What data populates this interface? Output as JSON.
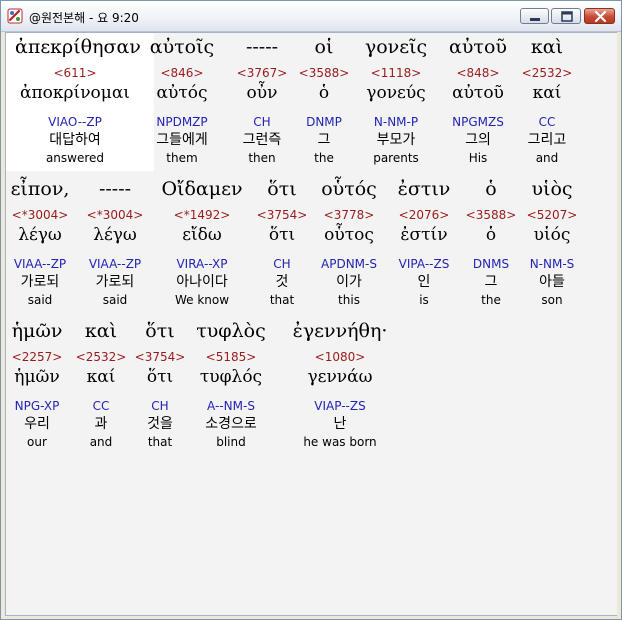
{
  "window": {
    "title": "@원전본해 - 요 9:20"
  },
  "rows": [
    {
      "words": [
        {
          "greek": "ἀπεκρίθησαν",
          "strong": "<611>",
          "lemma": "ἀποκρίνομαι",
          "parse": "VIAO--ZP",
          "korean": "대답하여",
          "english": "answered"
        },
        {
          "greek": "αὐτοῖς",
          "strong": "<846>",
          "lemma": "αὐτός",
          "parse": "NPDMZP",
          "korean": "그들에게",
          "english": "them"
        },
        {
          "greek": "-----",
          "strong": "<3767>",
          "lemma": "οὖν",
          "parse": "CH",
          "korean": "그런즉",
          "english": "then"
        },
        {
          "greek": "οἱ",
          "strong": "<3588>",
          "lemma": "ὁ",
          "parse": "DNMP",
          "korean": "그",
          "english": "the"
        },
        {
          "greek": "γονεῖς",
          "strong": "<1118>",
          "lemma": "γονεύς",
          "parse": "N-NM-P",
          "korean": "부모가",
          "english": "parents"
        },
        {
          "greek": "αὐτοῦ",
          "strong": "<848>",
          "lemma": "αὐτοῦ",
          "parse": "NPGMZS",
          "korean": "그의",
          "english": "His"
        },
        {
          "greek": "καὶ",
          "strong": "<2532>",
          "lemma": "καί",
          "parse": "CC",
          "korean": "그리고",
          "english": "and"
        }
      ]
    },
    {
      "words": [
        {
          "greek": "εἶπον,",
          "strong": "<*3004>",
          "lemma": "λέγω",
          "parse": "VIAA--ZP",
          "korean": "가로되",
          "english": "said"
        },
        {
          "greek": "-----",
          "strong": "<*3004>",
          "lemma": "λέγω",
          "parse": "VIAA--ZP",
          "korean": "가로되",
          "english": "said"
        },
        {
          "greek": "Οἴδαμεν",
          "strong": "<*1492>",
          "lemma": "εἴδω",
          "parse": "VIRA--XP",
          "korean": "아나이다",
          "english": "We know"
        },
        {
          "greek": "ὅτι",
          "strong": "<3754>",
          "lemma": "ὅτι",
          "parse": "CH",
          "korean": "것",
          "english": "that"
        },
        {
          "greek": "οὗτός",
          "strong": "<3778>",
          "lemma": "οὗτος",
          "parse": "APDNM-S",
          "korean": "이가",
          "english": "this"
        },
        {
          "greek": "ἐστιν",
          "strong": "<2076>",
          "lemma": "ἐστίν",
          "parse": "VIPA--ZS",
          "korean": "인",
          "english": "is"
        },
        {
          "greek": "ὁ",
          "strong": "<3588>",
          "lemma": "ὁ",
          "parse": "DNMS",
          "korean": "그",
          "english": "the"
        },
        {
          "greek": "υἱὸς",
          "strong": "<5207>",
          "lemma": "υἱός",
          "parse": "N-NM-S",
          "korean": "아들",
          "english": "son"
        }
      ]
    },
    {
      "words": [
        {
          "greek": "ἡμῶν",
          "strong": "<2257>",
          "lemma": "ἡμῶν",
          "parse": "NPG-XP",
          "korean": "우리",
          "english": "our"
        },
        {
          "greek": "καὶ",
          "strong": "<2532>",
          "lemma": "καί",
          "parse": "CC",
          "korean": "과",
          "english": "and"
        },
        {
          "greek": "ὅτι",
          "strong": "<3754>",
          "lemma": "ὅτι",
          "parse": "CH",
          "korean": "것을",
          "english": "that"
        },
        {
          "greek": "τυφλὸς",
          "strong": "<5185>",
          "lemma": "τυφλός",
          "parse": "A--NM-S",
          "korean": "소경으로",
          "english": "blind"
        },
        {
          "greek": "ἐγεννήθη·",
          "strong": "<1080>",
          "lemma": "γεννάω",
          "parse": "VIAP--ZS",
          "korean": "난",
          "english": "he was born"
        }
      ]
    }
  ]
}
